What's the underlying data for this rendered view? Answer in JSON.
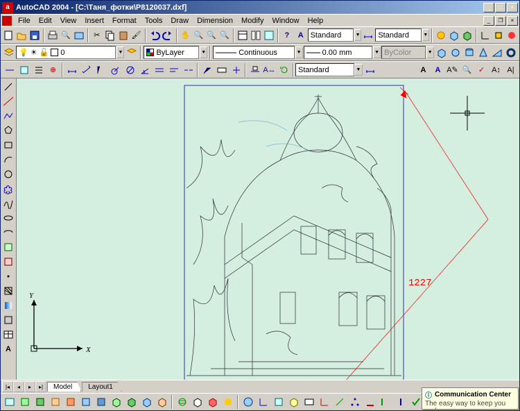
{
  "title": "AutoCAD 2004 - [C:\\Таня_фотки\\P8120037.dxf]",
  "menu": {
    "file": "File",
    "edit": "Edit",
    "view": "View",
    "insert": "Insert",
    "format": "Format",
    "tools": "Tools",
    "draw": "Draw",
    "dimension": "Dimension",
    "modify": "Modify",
    "window": "Window",
    "help": "Help"
  },
  "win_btns": {
    "min": "_",
    "max": "□",
    "close": "×"
  },
  "mdi_btns": {
    "min": "_",
    "restore": "❐",
    "close": "×"
  },
  "props": {
    "layer_state": "0",
    "color_label": "ByLayer",
    "linetype": "Continuous",
    "lineweight": "0.00 mm",
    "plotstyle": "ByColor"
  },
  "styles": {
    "text_style": "Standard",
    "dim_style": "Standard",
    "table_style": "Standard"
  },
  "tabs": {
    "model": "Model",
    "layout1": "Layout1"
  },
  "ucs": {
    "x": "X",
    "y": "Y"
  },
  "dimension_value": "1227",
  "comm_center": {
    "title": "Communication Center",
    "subtitle": "The easy way to keep you and y"
  },
  "icons": {
    "std_row": [
      "new",
      "open",
      "save",
      "plot",
      "preview",
      "publish",
      "cut",
      "copy",
      "paste",
      "matchprop",
      "undo",
      "redo",
      "pan",
      "zoom-rt",
      "zoom-win",
      "zoom-prev",
      "props",
      "dc",
      "tpal",
      "dbconn",
      "ws",
      "help"
    ],
    "obj_row": [
      "color",
      "linetype",
      "lineweight",
      "plotstyle"
    ],
    "layer_row": [
      "layer-props",
      "on",
      "freeze",
      "lock",
      "color",
      "layer-dd"
    ],
    "styles_row": [
      "text",
      "dimstyle",
      "table"
    ],
    "draw_col": [
      "line",
      "xline",
      "pline",
      "polygon",
      "rect",
      "arc",
      "circle",
      "revcloud",
      "spline",
      "ellipse",
      "ellipse-arc",
      "insert",
      "block",
      "point",
      "hatch",
      "gradient",
      "region",
      "table",
      "mtext"
    ],
    "mod_row": [
      "erase",
      "copy",
      "mirror",
      "offset",
      "array",
      "move",
      "rotate",
      "scale",
      "stretch",
      "trim",
      "extend",
      "break",
      "chamfer",
      "fillet",
      "explode"
    ],
    "dim_row": [
      "linear",
      "aligned",
      "ordinate",
      "radius",
      "diameter",
      "angular",
      "quick",
      "baseline",
      "continue",
      "leader",
      "tolerance",
      "center",
      "edit",
      "textedit",
      "update",
      "style"
    ],
    "view_row": [
      "named",
      "top",
      "bottom",
      "left",
      "right",
      "front",
      "back",
      "sw",
      "se",
      "ne",
      "nw",
      "3dorbit",
      "hide",
      "shade",
      "render",
      "ucs"
    ]
  }
}
